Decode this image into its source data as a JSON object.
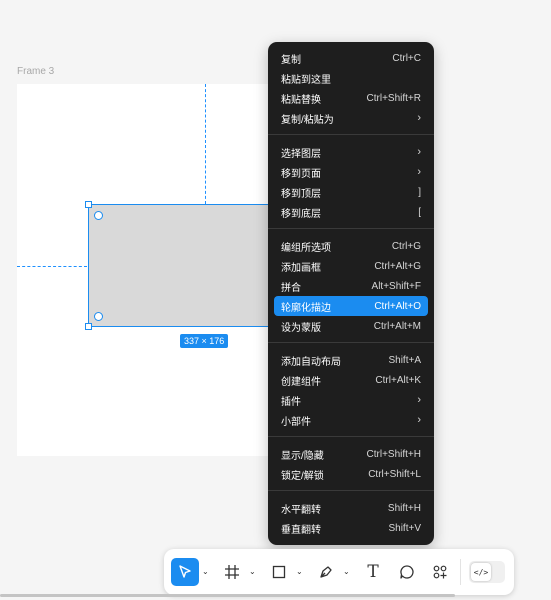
{
  "canvas": {
    "frame_label": "Frame 3",
    "size_badge": "337 × 176"
  },
  "menu": {
    "groups": [
      [
        {
          "label": "复制",
          "shortcut": "Ctrl+C"
        },
        {
          "label": "粘贴到这里",
          "shortcut": ""
        },
        {
          "label": "粘贴替换",
          "shortcut": "Ctrl+Shift+R"
        },
        {
          "label": "复制/粘贴为",
          "shortcut": "›"
        }
      ],
      [
        {
          "label": "选择图层",
          "shortcut": "›"
        },
        {
          "label": "移到页面",
          "shortcut": "›"
        },
        {
          "label": "移到顶层",
          "shortcut": "]"
        },
        {
          "label": "移到底层",
          "shortcut": "["
        }
      ],
      [
        {
          "label": "编组所选项",
          "shortcut": "Ctrl+G"
        },
        {
          "label": "添加画框",
          "shortcut": "Ctrl+Alt+G"
        },
        {
          "label": "拼合",
          "shortcut": "Alt+Shift+F"
        },
        {
          "label": "轮廓化描边",
          "shortcut": "Ctrl+Alt+O",
          "active": true
        },
        {
          "label": "设为蒙版",
          "shortcut": "Ctrl+Alt+M"
        }
      ],
      [
        {
          "label": "添加自动布局",
          "shortcut": "Shift+A"
        },
        {
          "label": "创建组件",
          "shortcut": "Ctrl+Alt+K"
        },
        {
          "label": "插件",
          "shortcut": "›"
        },
        {
          "label": "小部件",
          "shortcut": "›"
        }
      ],
      [
        {
          "label": "显示/隐藏",
          "shortcut": "Ctrl+Shift+H"
        },
        {
          "label": "锁定/解锁",
          "shortcut": "Ctrl+Shift+L"
        }
      ],
      [
        {
          "label": "水平翻转",
          "shortcut": "Shift+H"
        },
        {
          "label": "垂直翻转",
          "shortcut": "Shift+V"
        }
      ]
    ]
  },
  "toolbar": {
    "tools": [
      "move-tool",
      "frame-tool",
      "shape-tool",
      "pen-tool",
      "text-tool",
      "comment-tool",
      "actions-tool"
    ],
    "active_tool": "move-tool",
    "text_tool_glyph": "T",
    "dev_mode_glyph": "</>"
  },
  "colors": {
    "accent": "#1b8cf0",
    "menu_bg": "#1e1e1e",
    "canvas_bg": "#f5f5f5",
    "rect_fill": "#d9d9d9"
  }
}
